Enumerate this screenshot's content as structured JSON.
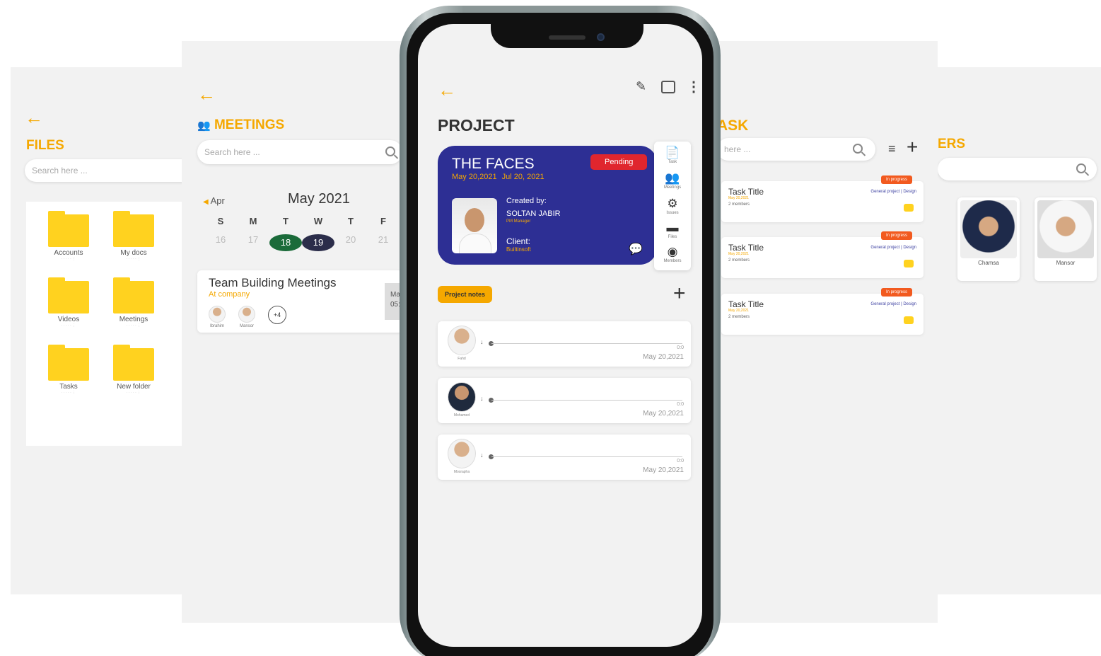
{
  "files": {
    "title": "FILES",
    "search_placeholder": "Search here ...",
    "folders": [
      {
        "label": "Accounts"
      },
      {
        "label": "My docs"
      },
      {
        "label": "Videos"
      },
      {
        "label": "Meetings"
      },
      {
        "label": "Tasks"
      },
      {
        "label": "New folder"
      }
    ]
  },
  "meetings": {
    "title": "MEETINGS",
    "search_placeholder": "Search here ...",
    "calendar": {
      "prev_month": "Apr",
      "month": "May 2021",
      "day_letters": [
        "S",
        "M",
        "T",
        "W",
        "T",
        "F"
      ],
      "days": [
        "16",
        "17",
        "18",
        "19",
        "20",
        "21"
      ]
    },
    "card": {
      "title": "Team Building Meetings",
      "location": "At company",
      "attendees": [
        "Ibrahim",
        "Mansor"
      ],
      "more": "+4",
      "side_time_a": "Ma",
      "side_time_b": "05:3"
    }
  },
  "project": {
    "title": "PROJECT",
    "card": {
      "name": "THE FACES",
      "start": "May 20,2021",
      "end": "Jul 20, 2021",
      "status": "Pending",
      "created_by_label": "Created by:",
      "creator": "SOLTAN JABIR",
      "creator_role": "PM Manager",
      "client_label": "Client:",
      "client": "Builtinsoft"
    },
    "side_menu": [
      "Task",
      "Meetings",
      "Issues",
      "Files",
      "Members"
    ],
    "notes_label": "Project notes",
    "add_label": "+",
    "notes": [
      {
        "name": "Fahd",
        "time": "0:0",
        "date": "May 20,2021"
      },
      {
        "name": "Mohamed",
        "time": "0:0",
        "date": "May 20,2021"
      },
      {
        "name": "Mosrapha",
        "time": "0:0",
        "date": "May 20,2021"
      }
    ]
  },
  "task": {
    "title": "ASK",
    "search_placeholder": "here ...",
    "cards": [
      {
        "title": "Task Title",
        "date": "May 20,2021",
        "members": "2 members",
        "status": "In progress",
        "project": "General project | Design"
      },
      {
        "title": "Task Title",
        "date": "May 20,2021",
        "members": "2 members",
        "status": "In progress",
        "project": "General project | Design"
      },
      {
        "title": "Task Title",
        "date": "May 20,2021",
        "members": "2 members",
        "status": "In progress",
        "project": "General project | Design"
      }
    ]
  },
  "users": {
    "title": "ERS",
    "cards": [
      {
        "name": "Chamsa"
      },
      {
        "name": "Mansor"
      }
    ]
  },
  "colors": {
    "accent": "#f5a800",
    "project_card": "#2d2f94",
    "pending": "#e0262e",
    "in_progress": "#f25a1f",
    "folder": "#ffd21f"
  }
}
